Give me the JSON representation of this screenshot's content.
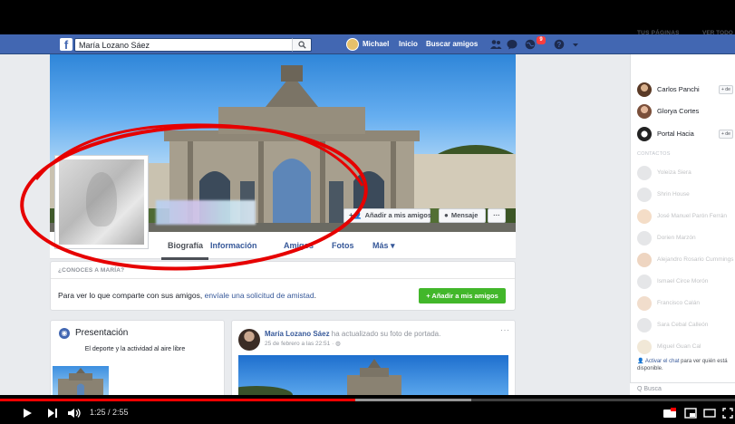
{
  "topbar": {
    "search_value": "María Lozano Sáez",
    "user_name": "Michael",
    "home_label": "Inicio",
    "find_friends_label": "Buscar amigos",
    "notifications_count": "9"
  },
  "profile": {
    "add_friend_label": "Añadir a mis amigos",
    "message_label": "Mensaje",
    "more_dots": "···"
  },
  "tabs": [
    {
      "label": "Biografía",
      "active": true
    },
    {
      "label": "Información"
    },
    {
      "label": "Amigos"
    },
    {
      "label": "Fotos"
    },
    {
      "label": "Más ▾"
    }
  ],
  "know_card": {
    "title": "¿CONOCES A MARÍA?",
    "text_prefix": "Para ver lo que comparte con sus amigos, ",
    "link_text": "envíale una solicitud de amistad",
    "text_suffix": ".",
    "button_label": "Añadir a mis amigos"
  },
  "presentation": {
    "title": "Presentación",
    "subtitle": "El deporte y la actividad al aire libre"
  },
  "post": {
    "author": "María Lozano Sáez",
    "action": " ha actualizado su foto de portada.",
    "time": "25 de febrero a las 22:51 · ",
    "more_dots": "···"
  },
  "right_column": {
    "pages_header": "TUS PÁGINAS",
    "see_all": "VER TODO",
    "pages": [
      {
        "name": "Carlos Panchi",
        "tag": "+ de"
      },
      {
        "name": "Glorya Cortes",
        "tag": ""
      },
      {
        "name": "Portal Hacia",
        "tag": "+ de"
      }
    ],
    "contacts_header": "CONTACTOS",
    "contacts": [
      "Yoleiza Siera",
      "Shrin House",
      "José Manuel Parón Ferrán",
      "Dorien Marzón",
      "Alejandro Rosario Cummings",
      "Ismael Circe Morón",
      "Francisco Calán",
      "Sara Cebal Calleón",
      "Miguel Guan Cal"
    ],
    "chat_link": "Activar el chat",
    "chat_text": " para ver quién está disponible.",
    "search_placeholder": "Q Busca"
  },
  "player": {
    "time_display": "1:25 / 2:55",
    "progress_fraction": 0.483
  },
  "colors": {
    "fb_blue": "#4267b2",
    "link_blue": "#365899",
    "green": "#42b72a",
    "annotation_red": "#e60000",
    "progress_red": "#ff0000"
  }
}
